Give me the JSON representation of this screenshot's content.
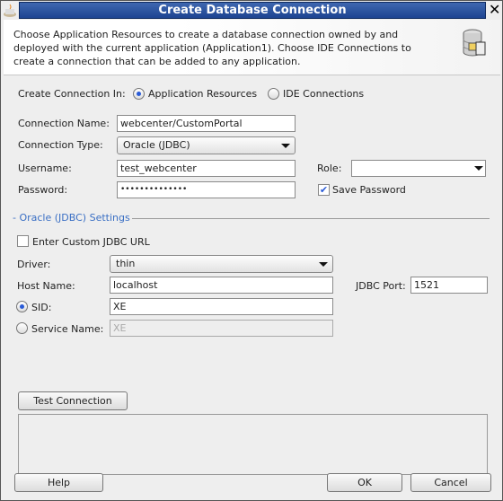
{
  "window": {
    "title": "Create Database Connection",
    "close_icon": "close-icon"
  },
  "header": {
    "description": "Choose Application Resources to create a database connection owned by and deployed with the current application (Application1). Choose IDE Connections to create a connection that can be added to any application.",
    "icon": "database-connection-icon"
  },
  "create_in": {
    "label": "Create Connection In:",
    "options": [
      {
        "label": "Application Resources",
        "selected": true
      },
      {
        "label": "IDE Connections",
        "selected": false
      }
    ]
  },
  "form": {
    "connection_name": {
      "label": "Connection Name:",
      "value": "webcenter/CustomPortal"
    },
    "connection_type": {
      "label": "Connection Type:",
      "value": "Oracle (JDBC)"
    },
    "username": {
      "label": "Username:",
      "value": "test_webcenter"
    },
    "role": {
      "label": "Role:",
      "value": ""
    },
    "password": {
      "label": "Password:",
      "value": "••••••••••••••"
    },
    "save_password": {
      "label": "Save Password",
      "checked": true
    }
  },
  "settings": {
    "title": "- Oracle (JDBC) Settings",
    "custom_url": {
      "label": "Enter Custom JDBC URL",
      "checked": false
    },
    "driver": {
      "label": "Driver:",
      "value": "thin"
    },
    "host": {
      "label": "Host Name:",
      "value": "localhost"
    },
    "port": {
      "label": "JDBC Port:",
      "value": "1521"
    },
    "sid": {
      "label": "SID:",
      "value": "XE",
      "selected": true
    },
    "service": {
      "label": "Service Name:",
      "value": "XE",
      "selected": false
    }
  },
  "buttons": {
    "test": "Test Connection",
    "help": "Help",
    "ok": "OK",
    "cancel": "Cancel"
  },
  "colors": {
    "title_bar": "#2a52a0",
    "accent": "#3a6fc4"
  }
}
